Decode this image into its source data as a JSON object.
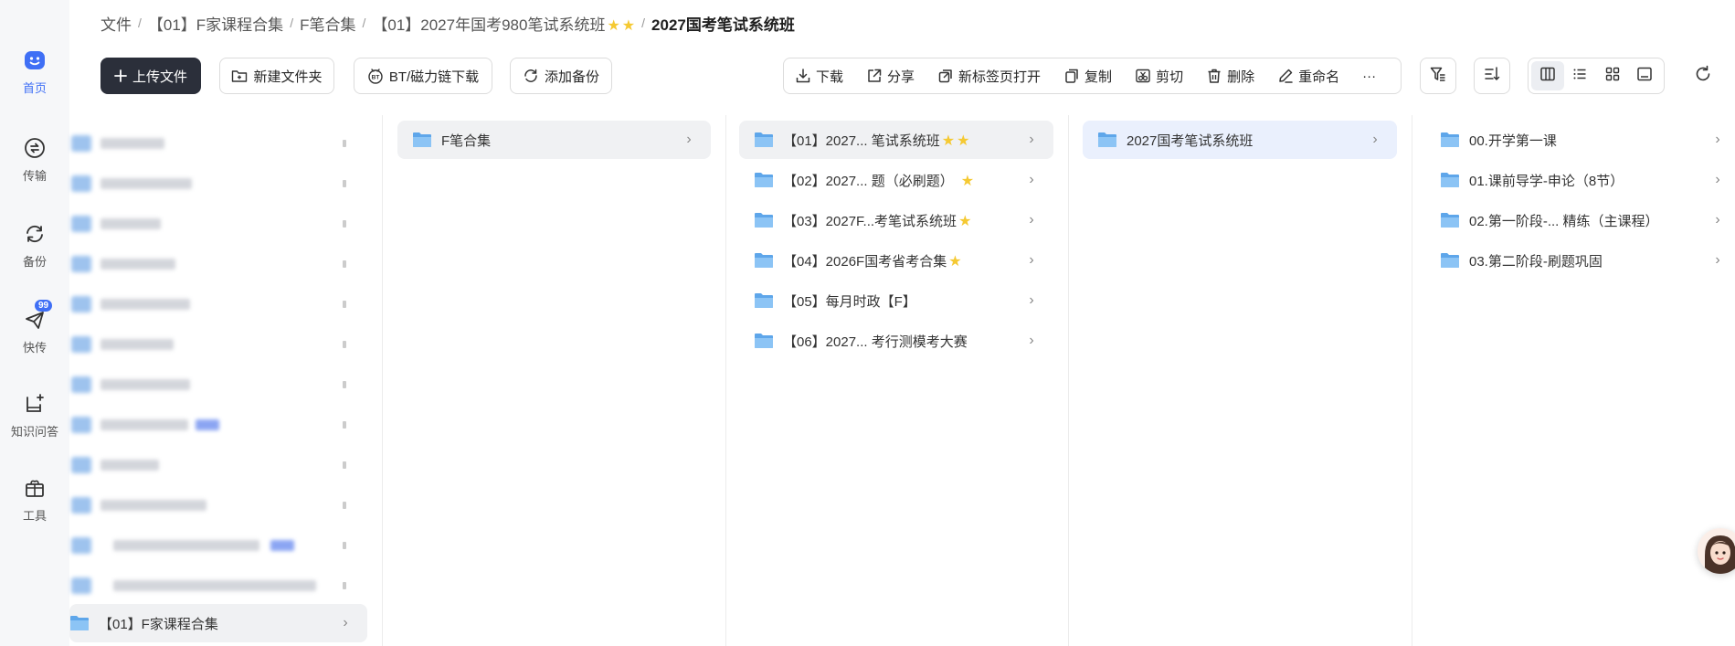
{
  "rail": {
    "items": [
      {
        "label": "首页",
        "icon": "home-icon",
        "active": true
      },
      {
        "label": "传输",
        "icon": "transfer-icon"
      },
      {
        "label": "备份",
        "icon": "backup-icon"
      },
      {
        "label": "快传",
        "icon": "quick-send-icon",
        "badge": "99"
      },
      {
        "label": "知识问答",
        "icon": "knowledge-qa-icon"
      },
      {
        "label": "工具",
        "icon": "toolbox-icon"
      }
    ]
  },
  "breadcrumb": {
    "root": "文件",
    "items": [
      "【01】F家课程合集",
      "F笔合集",
      "【01】2027年国考980笔试系统班"
    ],
    "current": "2027国考笔试系统班"
  },
  "toolbar": {
    "upload": "上传文件",
    "new_folder": "新建文件夹",
    "bt_download": "BT/磁力链下载",
    "add_backup": "添加备份",
    "actions": {
      "download": "下载",
      "share": "分享",
      "open_new_tab": "新标签页打开",
      "copy": "复制",
      "cut": "剪切",
      "delete": "删除",
      "rename": "重命名",
      "more": "···"
    }
  },
  "columns": {
    "col1": {
      "selected_item": "【01】F家课程合集"
    },
    "col2": {
      "items": [
        "F笔合集"
      ]
    },
    "col3": {
      "items": [
        "【01】2027... 笔试系统班",
        "【02】2027... 题（必刷题）",
        "【03】2027F...考笔试系统班",
        "【04】2026F国考省考合集",
        "【05】每月时政【F】",
        "【06】2027...  考行测模考大赛"
      ]
    },
    "col4": {
      "items": [
        "2027国考笔试系统班"
      ]
    },
    "col5": {
      "items": [
        "00.开学第一课",
        "01.课前导学-申论（8节）",
        "02.第一阶段-...  精练（主课程）",
        "03.第二阶段-刷题巩固"
      ]
    }
  },
  "colors": {
    "accent": "#3f6ff5",
    "star": "#f5c932",
    "folder": "#5ea6ea",
    "primary_button": "#2b2f3a"
  }
}
